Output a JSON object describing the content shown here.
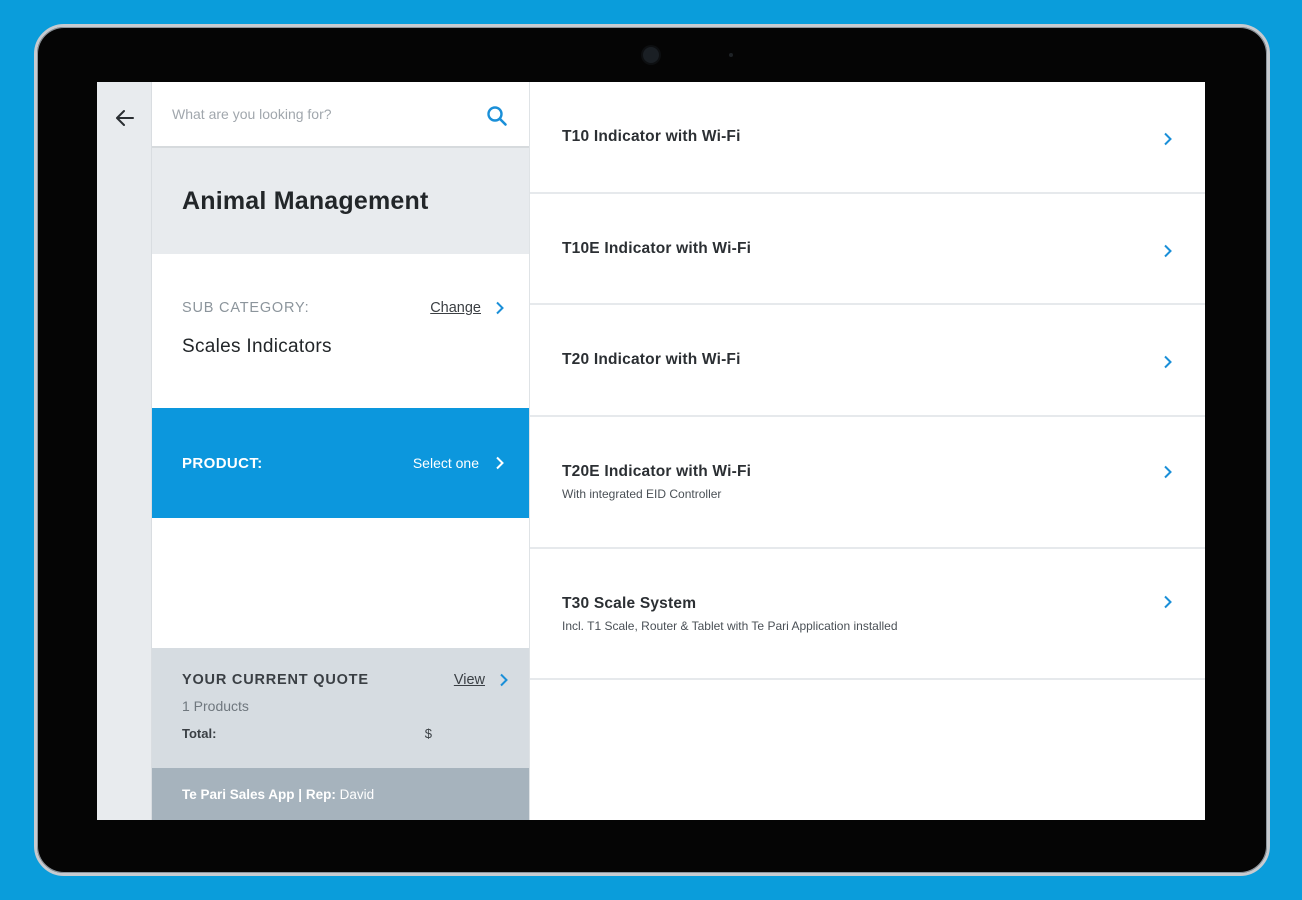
{
  "search": {
    "placeholder": "What are you looking for?"
  },
  "category": {
    "title": "Animal Management"
  },
  "subcategory": {
    "label": "SUB CATEGORY:",
    "change_label": "Change",
    "value": "Scales Indicators"
  },
  "product": {
    "label": "PRODUCT:",
    "select_label": "Select one"
  },
  "quote": {
    "title": "YOUR CURRENT QUOTE",
    "view_label": "View",
    "count": "1 Products",
    "total_label": "Total:",
    "total_value": "$"
  },
  "footer": {
    "app": "Te Pari Sales App | Rep:",
    "rep": "David"
  },
  "products": [
    {
      "title": "T10 Indicator with Wi-Fi",
      "subtitle": ""
    },
    {
      "title": "T10E Indicator with Wi-Fi",
      "subtitle": ""
    },
    {
      "title": "T20 Indicator with Wi-Fi",
      "subtitle": ""
    },
    {
      "title": "T20E Indicator with Wi-Fi",
      "subtitle": "With integrated EID Controller"
    },
    {
      "title": "T30 Scale System",
      "subtitle": "Incl. T1 Scale, Router & Tablet with Te Pari Application installed"
    }
  ],
  "colors": {
    "background": "#0a9ddb",
    "accent": "#0c97dd",
    "chevron": "#1a8fd8"
  },
  "icons": {
    "back": "arrow-left-icon",
    "search": "search-icon",
    "chevron": "chevron-right-icon"
  }
}
